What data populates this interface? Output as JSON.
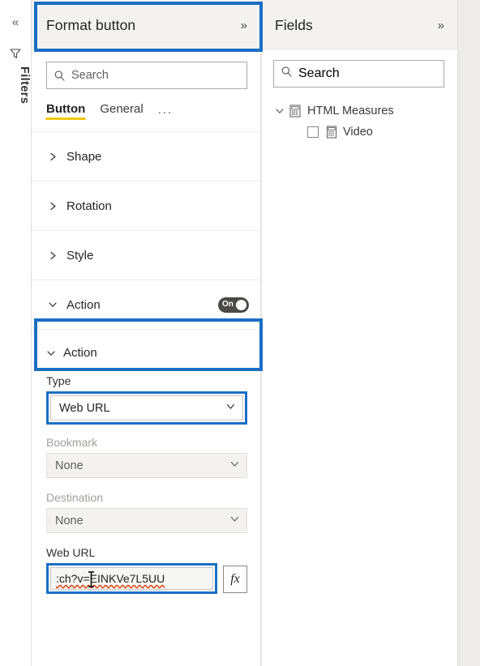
{
  "filter_rail": {
    "collapse_icon": "chevron-double-left-icon",
    "funnel_icon": "filter-funnel-icon",
    "label": "Filters"
  },
  "format_panel": {
    "title": "Format button",
    "expand_icon": "chevron-double-right-icon",
    "search": {
      "placeholder": "Search",
      "icon": "search-icon"
    },
    "tabs": [
      {
        "label": "Button",
        "active": true
      },
      {
        "label": "General",
        "active": false
      },
      {
        "label": "...",
        "active": false
      }
    ],
    "sections": [
      {
        "label": "Shape",
        "expanded": false,
        "chevron": "chevron-right-icon"
      },
      {
        "label": "Rotation",
        "expanded": false,
        "chevron": "chevron-right-icon"
      },
      {
        "label": "Style",
        "expanded": false,
        "chevron": "chevron-right-icon"
      },
      {
        "label": "Action",
        "expanded": true,
        "chevron": "chevron-down-icon",
        "toggle_state": "On"
      }
    ],
    "action": {
      "subheader": "Action",
      "subheader_chevron": "chevron-down-icon",
      "type": {
        "label": "Type",
        "value": "Web URL",
        "chevron": "chevron-down-icon",
        "highlighted": true
      },
      "bookmark": {
        "label": "Bookmark",
        "value": "None",
        "chevron": "chevron-down-icon",
        "disabled": true
      },
      "destination": {
        "label": "Destination",
        "value": "None",
        "chevron": "chevron-down-icon",
        "disabled": true
      },
      "web_url": {
        "label": "Web URL",
        "value": ":ch?v=EINKVe7L5UU",
        "fx_label": "fx",
        "highlighted": true,
        "spellcheck_underline": true,
        "cursor": "text-ibeam-cursor"
      }
    }
  },
  "fields_panel": {
    "title": "Fields",
    "expand_icon": "chevron-double-right-icon",
    "search": {
      "placeholder": "Search",
      "icon": "search-icon"
    },
    "tree": [
      {
        "label": "HTML Measures",
        "icon": "table-measure-icon",
        "chevron": "chevron-down-icon",
        "level": 0,
        "checked": false,
        "has_checkbox": false
      },
      {
        "label": "Video",
        "icon": "measure-icon",
        "level": 1,
        "checked": false,
        "has_checkbox": true
      }
    ]
  },
  "annotations": {
    "accent_color": "#1a6fc4",
    "highlight_header": "Format button",
    "highlight_action": "Action",
    "highlight_type": "Web URL",
    "highlight_web_url": ":ch?v=EINKVe7L5UU"
  },
  "theme": {
    "accent_tab": "#f2c811",
    "panel_header_bg": "#f3f2f1",
    "toggle_on_bg": "#4c4a48",
    "spell_error": "#d83b01"
  }
}
